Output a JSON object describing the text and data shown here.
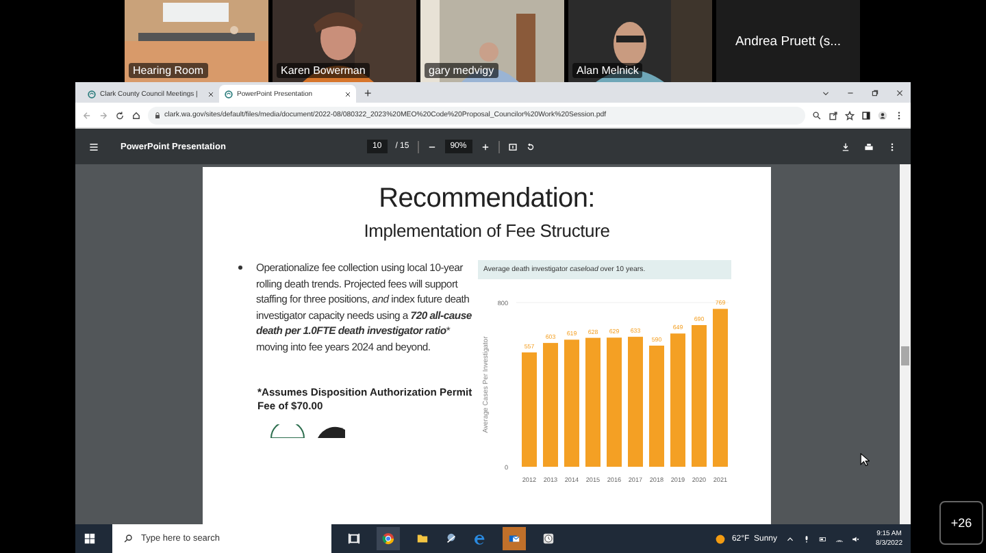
{
  "participants": [
    {
      "name": "Hearing Room",
      "kind": "video"
    },
    {
      "name": "Karen Bowerman",
      "kind": "video"
    },
    {
      "name": "gary medvigy",
      "kind": "video"
    },
    {
      "name": "Alan Melnick",
      "kind": "video"
    },
    {
      "name": "Andrea Pruett (s...",
      "kind": "name_only"
    }
  ],
  "browser": {
    "tabs": [
      {
        "title": "Clark County Council Meetings |",
        "selected": false
      },
      {
        "title": "PowerPoint Presentation",
        "selected": true
      }
    ],
    "new_tab": "+",
    "url": "clark.wa.gov/sites/default/files/media/document/2022-08/080322_2023%20MEO%20Code%20Proposal_Councilor%20Work%20Session.pdf"
  },
  "pdf_toolbar": {
    "title": "PowerPoint Presentation",
    "page": "10",
    "page_total": "/ 15",
    "zoom": "90%"
  },
  "slide": {
    "title": "Recommendation:",
    "subtitle": "Implementation of Fee Structure",
    "bullet": "Operationalize fee collection using local 10-year rolling death trends. Projected fees will support staffing for three positions, *and* index future death investigator capacity needs using a **720 all-cause death per 1.0FTE death investigator ratio*** moving into fee years 2024 and beyond.",
    "footnote": "*Assumes Disposition Authorization Permit Fee of $70.00",
    "chart_data": {
      "type": "bar",
      "title": "Average death investigator *caseload* over 10 years.",
      "ylabel": "Average Cases Per Investigator",
      "categories": [
        "2012",
        "2013",
        "2014",
        "2015",
        "2016",
        "2017",
        "2018",
        "2019",
        "2020",
        "2021"
      ],
      "series": [
        {
          "color": "#f4a024",
          "values": [
            557,
            603,
            619,
            628,
            629,
            633,
            590,
            649,
            690,
            769
          ]
        }
      ],
      "ylim": [
        0,
        800
      ],
      "yticks": [
        0,
        800
      ],
      "data_labels": true
    }
  },
  "taskbar": {
    "search_placeholder": "Type here to search",
    "weather": "62°F  Sunny",
    "time": "9:15 AM",
    "date": "8/3/2022"
  },
  "overflow_badge": "+26"
}
